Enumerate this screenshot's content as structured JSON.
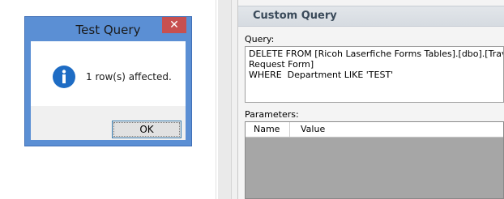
{
  "dialog": {
    "title": "Test Query",
    "close_glyph": "✕",
    "message": "1 row(s) affected.",
    "icon": "info-icon",
    "ok_label": "OK"
  },
  "panel": {
    "header": "Custom Query",
    "query_label": "Query:",
    "query_lines": [
      "DELETE FROM [Ricoh Laserfiche Forms Tables].[dbo].[Travel",
      "Request Form]",
      "WHERE  Department LIKE 'TEST'"
    ],
    "parameters_label": "Parameters:",
    "columns": [
      "Name",
      "Value"
    ]
  },
  "colors": {
    "dialog_frame": "#5b8fd4",
    "close_button": "#c75050",
    "info_icon": "#1e6cc4",
    "panel_header_text": "#3a4a5a"
  }
}
